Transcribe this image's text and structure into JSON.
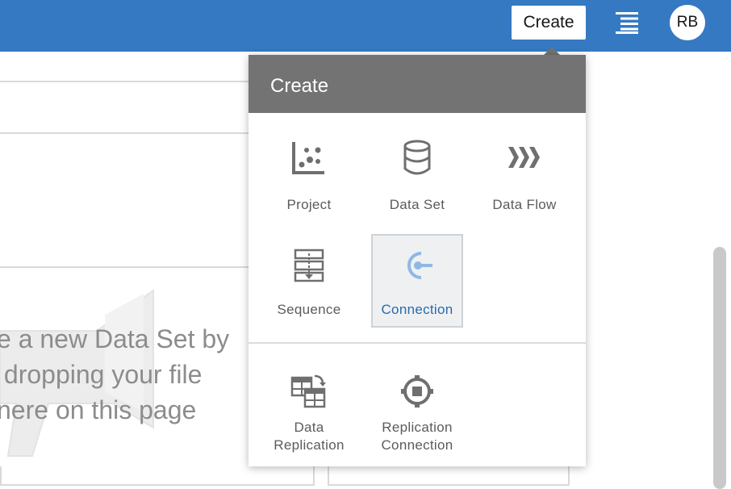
{
  "header": {
    "create_label": "Create",
    "menu_icon": "hamburger-menu-icon",
    "avatar_initials": "RB",
    "bar_color": "#3579c2"
  },
  "background": {
    "drop_text": "e a new Data Set by\n dropping your file\nnere on this page"
  },
  "create_menu": {
    "title": "Create",
    "items": [
      {
        "label": "Project",
        "icon": "scatter-plot-icon"
      },
      {
        "label": "Data Set",
        "icon": "database-icon"
      },
      {
        "label": "Data Flow",
        "icon": "chevrons-flow-icon"
      },
      {
        "label": "Sequence",
        "icon": "sequence-icon"
      },
      {
        "label": "Connection",
        "icon": "connection-plug-icon",
        "selected": true
      },
      {
        "label": "Data\nReplication",
        "icon": "data-replication-icon"
      },
      {
        "label": "Replication\nConnection",
        "icon": "replication-connection-icon"
      }
    ],
    "selected_color": "#2a6bad"
  }
}
